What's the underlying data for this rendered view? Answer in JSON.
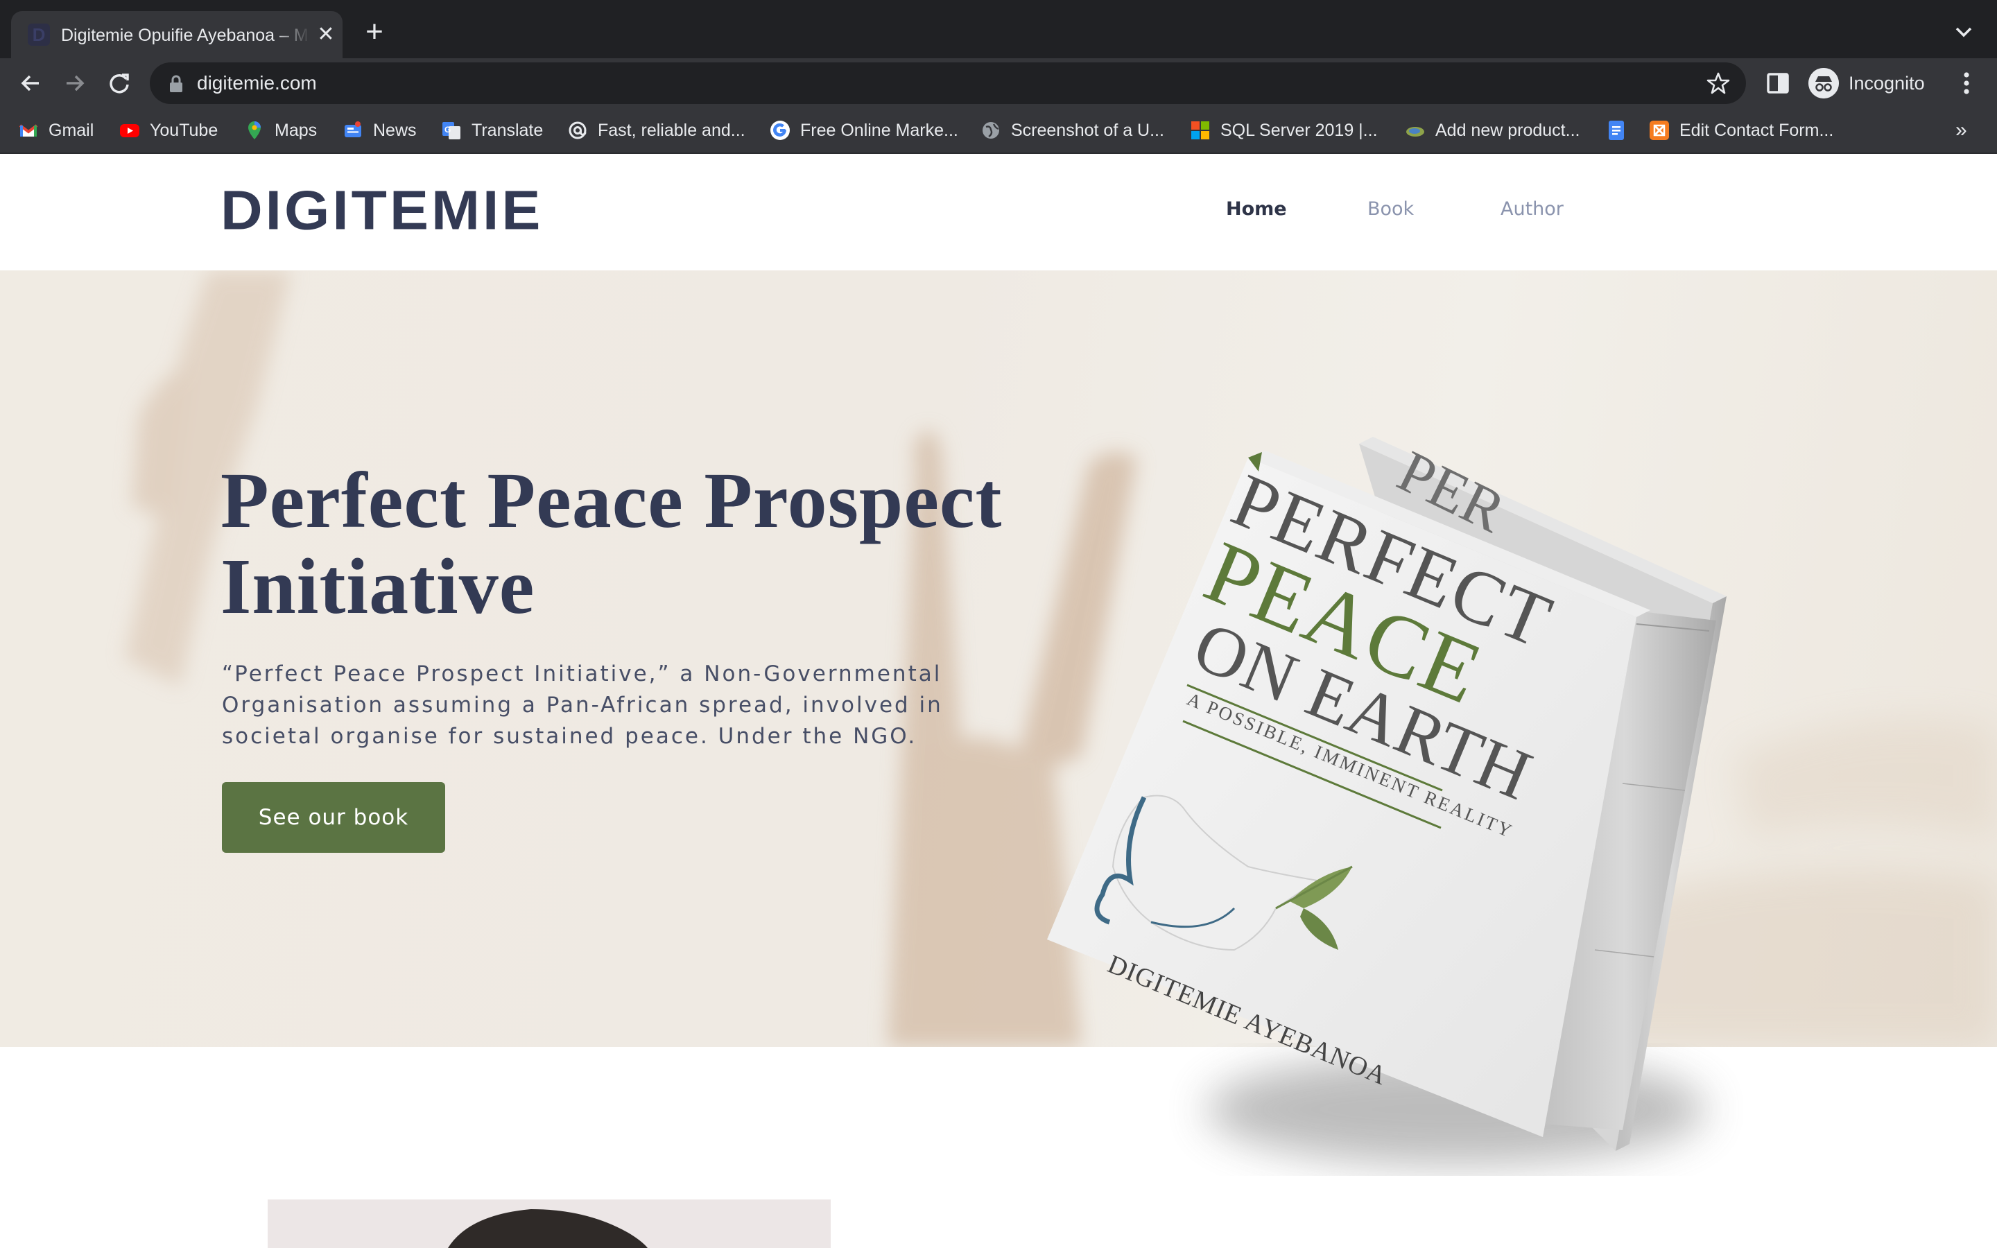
{
  "browser": {
    "tab": {
      "title": "Digitemie Opuifie Ayebanoa – M"
    },
    "address_bar": {
      "url": "digitemie.com"
    },
    "profile": {
      "label": "Incognito"
    },
    "bookmarks": [
      {
        "label": "Gmail",
        "icon": "gmail-icon"
      },
      {
        "label": "YouTube",
        "icon": "youtube-icon"
      },
      {
        "label": "Maps",
        "icon": "maps-icon"
      },
      {
        "label": "News",
        "icon": "news-icon"
      },
      {
        "label": "Translate",
        "icon": "translate-icon"
      },
      {
        "label": "Fast, reliable and...",
        "icon": "at-icon"
      },
      {
        "label": "Free Online Marke...",
        "icon": "google-icon"
      },
      {
        "label": "Screenshot of a U...",
        "icon": "globe-icon"
      },
      {
        "label": "SQL Server 2019 |...",
        "icon": "microsoft-icon"
      },
      {
        "label": "Add new product...",
        "icon": "store-icon"
      },
      {
        "label": "",
        "icon": "docs-icon"
      },
      {
        "label": "Edit Contact Form...",
        "icon": "form-icon"
      }
    ],
    "bookmarks_overflow": "»"
  },
  "site": {
    "logo": "DIGITEMIE",
    "nav": [
      {
        "label": "Home",
        "active": true
      },
      {
        "label": "Book",
        "active": false
      },
      {
        "label": "Author",
        "active": false
      }
    ]
  },
  "hero": {
    "title": "Perfect Peace Prospect Initiative",
    "description": "“Perfect Peace Prospect Initiative,” a Non-Governmental Organisation assuming a Pan-African spread, involved in societal organise for sustained peace. Under the NGO.",
    "cta_label": "See our book"
  },
  "book_cover": {
    "line1": "PERFECT",
    "line2": "PEACE",
    "line3": "ON EARTH",
    "subtitle": "A POSSIBLE, IMMINENT REALITY",
    "author": "DIGITEMIE AYEBANOA",
    "back_book_peek": "PER"
  },
  "colors": {
    "brand_navy": "#333a54",
    "button_green": "#5b7443",
    "cover_green": "#5d7a3a",
    "nav_muted": "#8a93ad"
  }
}
